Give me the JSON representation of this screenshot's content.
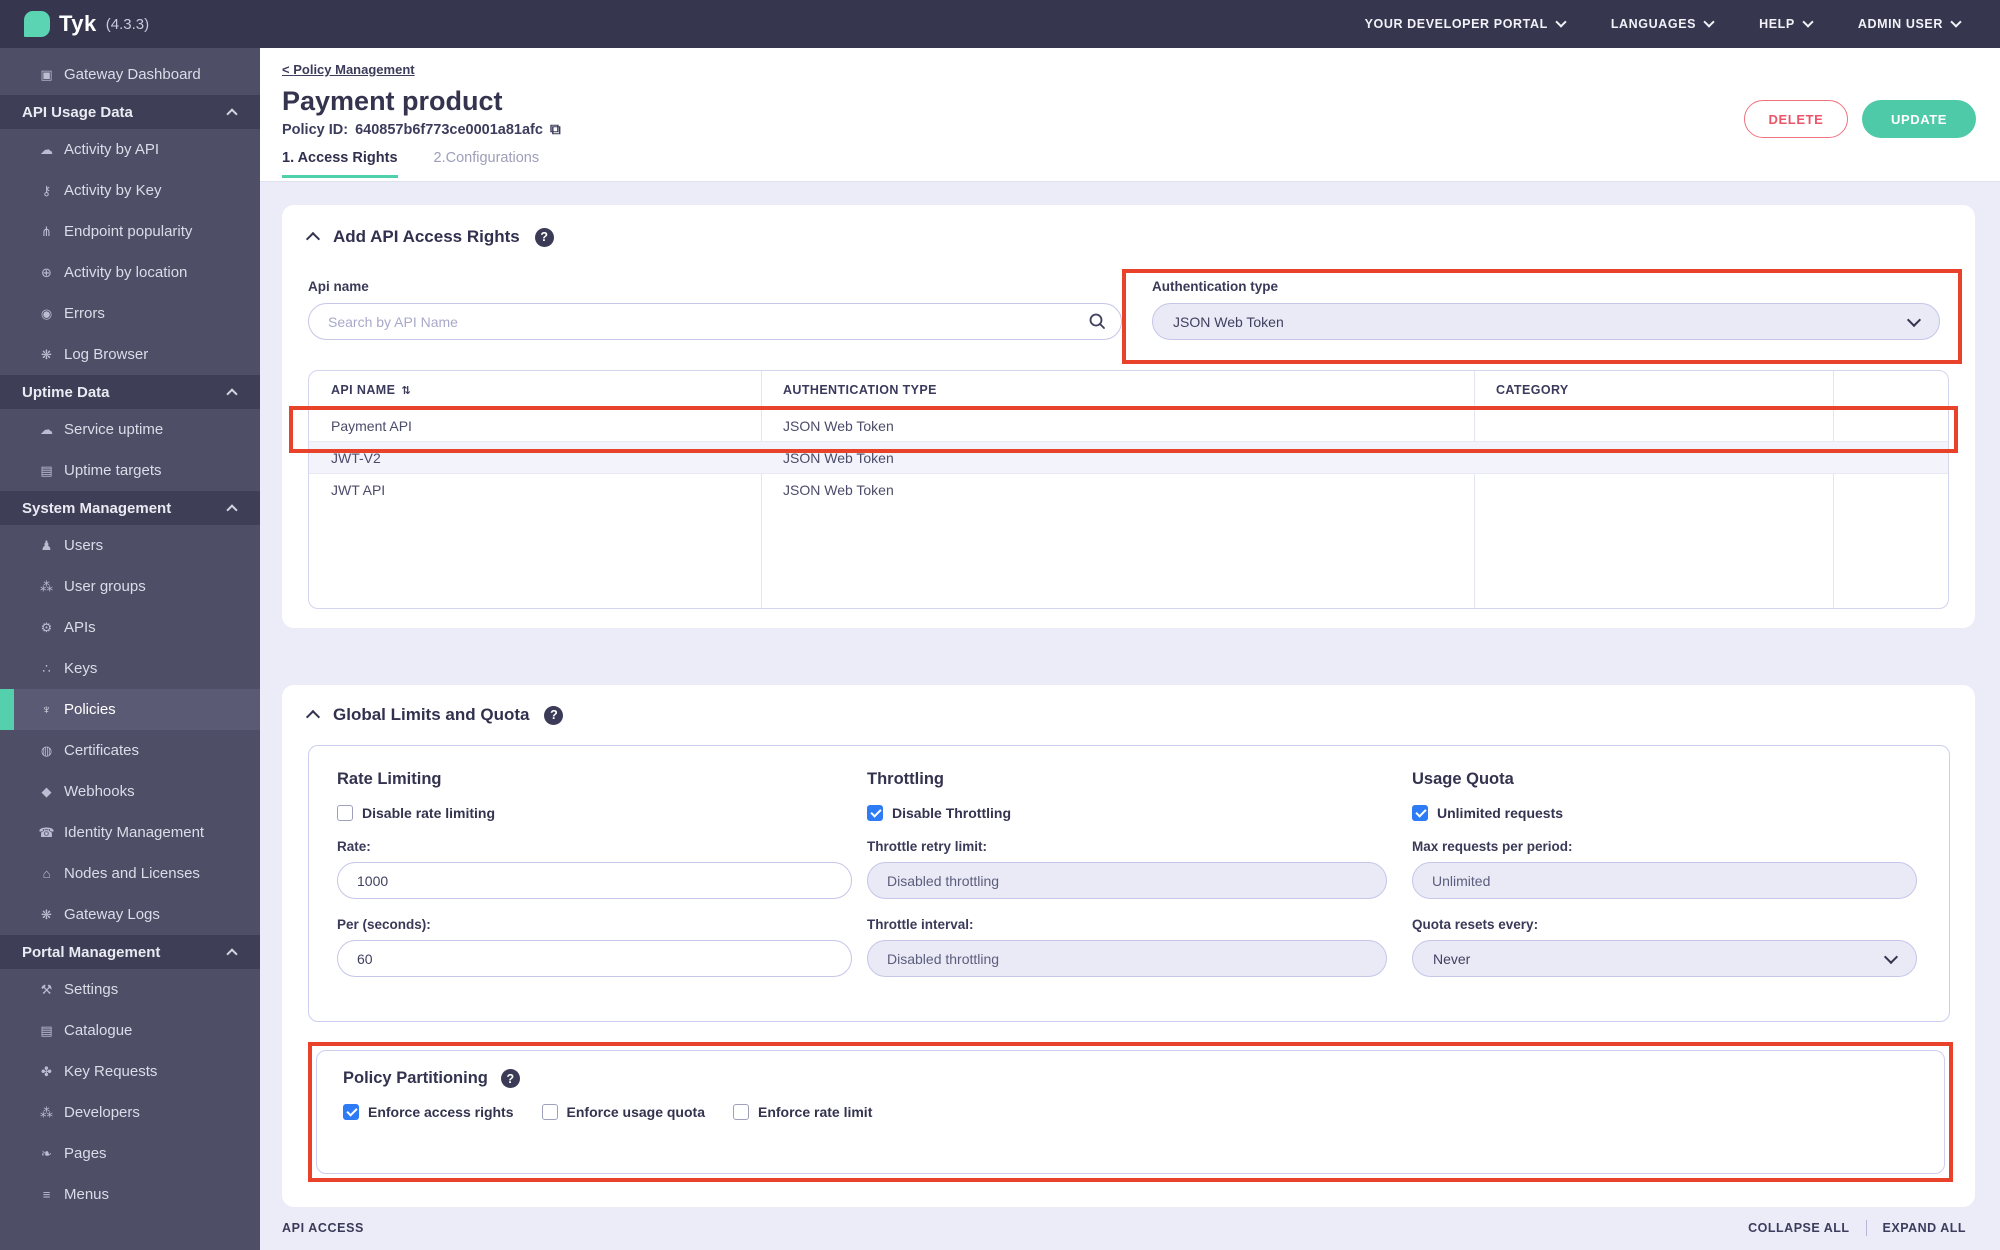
{
  "colors": {
    "accent_teal": "#4fcaa8",
    "annotation_red": "#e8432a",
    "checkbox_blue": "#2e7bf6",
    "danger_red": "#ee5468",
    "nav_dark": "#36364e",
    "sidebar_bg": "#4e4e67"
  },
  "topbar": {
    "brand": "Tyk",
    "version": "(4.3.3)",
    "menus": [
      {
        "label": "YOUR DEVELOPER PORTAL"
      },
      {
        "label": "LANGUAGES"
      },
      {
        "label": "HELP"
      },
      {
        "label": "ADMIN USER"
      }
    ]
  },
  "sidebar": {
    "items": [
      {
        "kind": "item",
        "icon": "monitor-icon",
        "glyph": "▣",
        "label": "Gateway Dashboard"
      },
      {
        "kind": "header",
        "icon": "",
        "glyph": "",
        "label": "API Usage Data"
      },
      {
        "kind": "item",
        "icon": "cloud-icon",
        "glyph": "☁",
        "label": "Activity by API"
      },
      {
        "kind": "item",
        "icon": "key-icon",
        "glyph": "⚷",
        "label": "Activity by Key"
      },
      {
        "kind": "item",
        "icon": "branch-icon",
        "glyph": "⋔",
        "label": "Endpoint popularity"
      },
      {
        "kind": "item",
        "icon": "globe-icon",
        "glyph": "⊕",
        "label": "Activity by location"
      },
      {
        "kind": "item",
        "icon": "error-icon",
        "glyph": "◉",
        "label": "Errors"
      },
      {
        "kind": "item",
        "icon": "bug-icon",
        "glyph": "❋",
        "label": "Log Browser"
      },
      {
        "kind": "header",
        "icon": "",
        "glyph": "",
        "label": "Uptime Data"
      },
      {
        "kind": "item",
        "icon": "cloud-uptime-icon",
        "glyph": "☁",
        "label": "Service uptime"
      },
      {
        "kind": "item",
        "icon": "list-icon",
        "glyph": "▤",
        "label": "Uptime targets"
      },
      {
        "kind": "header",
        "icon": "",
        "glyph": "",
        "label": "System Management"
      },
      {
        "kind": "item",
        "icon": "user-icon",
        "glyph": "♟",
        "label": "Users"
      },
      {
        "kind": "item",
        "icon": "user-group-icon",
        "glyph": "⁂",
        "label": "User groups"
      },
      {
        "kind": "item",
        "icon": "gears-icon",
        "glyph": "⚙",
        "label": "APIs"
      },
      {
        "kind": "item",
        "icon": "sitemap-icon",
        "glyph": "∴",
        "label": "Keys"
      },
      {
        "kind": "item",
        "icon": "plug-icon",
        "glyph": "♆",
        "label": "Policies",
        "active": true
      },
      {
        "kind": "item",
        "icon": "certificate-icon",
        "glyph": "◍",
        "label": "Certificates"
      },
      {
        "kind": "item",
        "icon": "bell-icon",
        "glyph": "◆",
        "label": "Webhooks"
      },
      {
        "kind": "item",
        "icon": "phone-icon",
        "glyph": "☎",
        "label": "Identity Management"
      },
      {
        "kind": "item",
        "icon": "bank-icon",
        "glyph": "⌂",
        "label": "Nodes and Licenses"
      },
      {
        "kind": "item",
        "icon": "bug-icon",
        "glyph": "❋",
        "label": "Gateway Logs"
      },
      {
        "kind": "header",
        "icon": "",
        "glyph": "",
        "label": "Portal Management"
      },
      {
        "kind": "item",
        "icon": "wrench-icon",
        "glyph": "⚒",
        "label": "Settings"
      },
      {
        "kind": "item",
        "icon": "catalogue-icon",
        "glyph": "▤",
        "label": "Catalogue"
      },
      {
        "kind": "item",
        "icon": "paw-icon",
        "glyph": "✤",
        "label": "Key Requests"
      },
      {
        "kind": "item",
        "icon": "developers-icon",
        "glyph": "⁂",
        "label": "Developers"
      },
      {
        "kind": "item",
        "icon": "leaf-icon",
        "glyph": "❧",
        "label": "Pages"
      },
      {
        "kind": "item",
        "icon": "menu-icon",
        "glyph": "≡",
        "label": "Menus"
      }
    ]
  },
  "header": {
    "breadcrumb_prefix": "<",
    "breadcrumb": "Policy Management",
    "title": "Payment product",
    "policy_id_label": "Policy ID:",
    "policy_id": "640857b6f773ce0001a81afc",
    "copy_glyph": "⧉",
    "tabs": [
      {
        "label": "1. Access Rights"
      },
      {
        "label": "2.Configurations"
      }
    ],
    "delete_label": "DELETE",
    "update_label": "UPDATE"
  },
  "access_section": {
    "title": "Add API Access Rights",
    "help_glyph": "?",
    "api_name_label": "Api name",
    "search_placeholder": "Search by API Name",
    "auth_label": "Authentication type",
    "auth_value": "JSON Web Token",
    "table": {
      "sort_glyph": "⇅",
      "headers": [
        "API NAME",
        "AUTHENTICATION TYPE",
        "CATEGORY",
        ""
      ],
      "rows": [
        {
          "cols": [
            "Payment API",
            "JSON Web Token",
            "",
            ""
          ],
          "highlight": true
        },
        {
          "cols": [
            "JWT-V2",
            "JSON Web Token",
            "",
            ""
          ],
          "stripe": true
        },
        {
          "cols": [
            "JWT API",
            "JSON Web Token",
            "",
            ""
          ]
        }
      ]
    }
  },
  "limits_section": {
    "title": "Global Limits and Quota",
    "help_glyph": "?",
    "rate": {
      "title": "Rate Limiting",
      "checkbox": "Disable rate limiting",
      "checked": false,
      "rate_label": "Rate:",
      "rate_value": "1000",
      "per_label": "Per (seconds):",
      "per_value": "60"
    },
    "throttle": {
      "title": "Throttling",
      "checkbox": "Disable Throttling",
      "checked": true,
      "retry_label": "Throttle retry limit:",
      "retry_value": "Disabled throttling",
      "interval_label": "Throttle interval:",
      "interval_value": "Disabled throttling"
    },
    "quota": {
      "title": "Usage Quota",
      "checkbox": "Unlimited requests",
      "checked": true,
      "max_label": "Max requests per period:",
      "max_value": "Unlimited",
      "resets_label": "Quota resets every:",
      "resets_value": "Never"
    }
  },
  "partition_section": {
    "title": "Policy Partitioning",
    "help_glyph": "?",
    "checkboxes": [
      {
        "label": "Enforce access rights",
        "checked": true
      },
      {
        "label": "Enforce usage quota",
        "checked": false
      },
      {
        "label": "Enforce rate limit",
        "checked": false
      }
    ]
  },
  "footer": {
    "left": "API ACCESS",
    "collapse": "COLLAPSE ALL",
    "expand": "EXPAND ALL"
  }
}
